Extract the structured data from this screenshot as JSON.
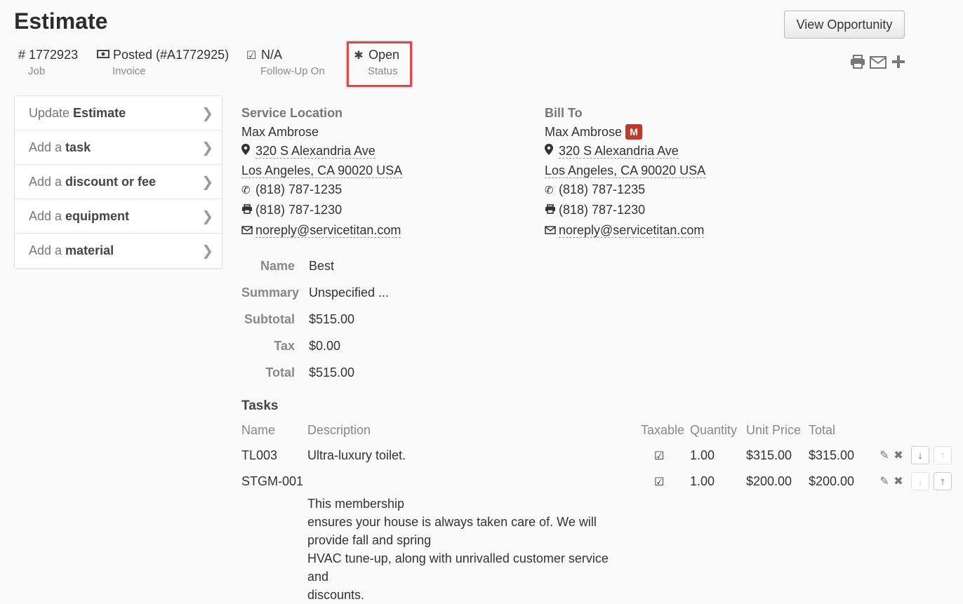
{
  "page": {
    "title": "Estimate",
    "view_opportunity_label": "View Opportunity"
  },
  "meta": {
    "job": {
      "value": "# 1772923",
      "label": "Job"
    },
    "invoice": {
      "value": "Posted (#A1772925)",
      "label": "Invoice"
    },
    "followup": {
      "value": "N/A",
      "label": "Follow-Up On"
    },
    "status": {
      "value": "Open",
      "label": "Status"
    }
  },
  "sidebar": {
    "items": [
      {
        "prefix": "Update ",
        "bold": "Estimate"
      },
      {
        "prefix": "Add a ",
        "bold": "task"
      },
      {
        "prefix": "Add a ",
        "bold": "discount or fee"
      },
      {
        "prefix": "Add a ",
        "bold": "equipment"
      },
      {
        "prefix": "Add a ",
        "bold": "material"
      }
    ]
  },
  "service_location": {
    "heading": "Service Location",
    "name": "Max Ambrose",
    "street": "320 S Alexandria Ave",
    "city": "Los Angeles, CA 90020 USA",
    "phone": "(818) 787-1235",
    "fax": "(818) 787-1230",
    "email": "noreply@servicetitan.com"
  },
  "bill_to": {
    "heading": "Bill To",
    "name": "Max Ambrose",
    "badge": "M",
    "street": "320 S Alexandria Ave",
    "city": "Los Angeles, CA 90020 USA",
    "phone": "(818) 787-1235",
    "fax": "(818) 787-1230",
    "email": "noreply@servicetitan.com"
  },
  "summary": {
    "name_label": "Name",
    "name_value": "Best",
    "summary_label": "Summary",
    "summary_value": "Unspecified ...",
    "subtotal_label": "Subtotal",
    "subtotal_value": "$515.00",
    "tax_label": "Tax",
    "tax_value": "$0.00",
    "total_label": "Total",
    "total_value": "$515.00"
  },
  "tasks": {
    "title": "Tasks",
    "columns": {
      "name": "Name",
      "description": "Description",
      "taxable": "Taxable",
      "quantity": "Quantity",
      "unit_price": "Unit Price",
      "total": "Total"
    },
    "rows": [
      {
        "name": "TL003",
        "description": "Ultra-luxury toilet.",
        "taxable": true,
        "quantity": "1.00",
        "unit_price": "$315.00",
        "total": "$315.00"
      },
      {
        "name": "STGM-001",
        "description": "This membership\nensures your house is always taken care of. We will\nprovide fall and spring\nHVAC tune-up, along with unrivalled customer service and\ndiscounts.",
        "taxable": true,
        "quantity": "1.00",
        "unit_price": "$200.00",
        "total": "$200.00"
      }
    ]
  },
  "colors": {
    "status_highlight": "#e0474c",
    "badge": "#c0392b"
  },
  "icons": {
    "meta": [
      "money-icon",
      "check-square-icon",
      "asterisk-icon"
    ],
    "top_actions": [
      "print-icon",
      "envelope-icon",
      "plus-icon"
    ],
    "address": [
      "map-marker-icon",
      "phone-icon",
      "fax-icon",
      "envelope-icon"
    ],
    "row_actions": [
      "pencil-icon",
      "remove-icon",
      "arrow-down-icon",
      "arrow-up-icon"
    ]
  }
}
